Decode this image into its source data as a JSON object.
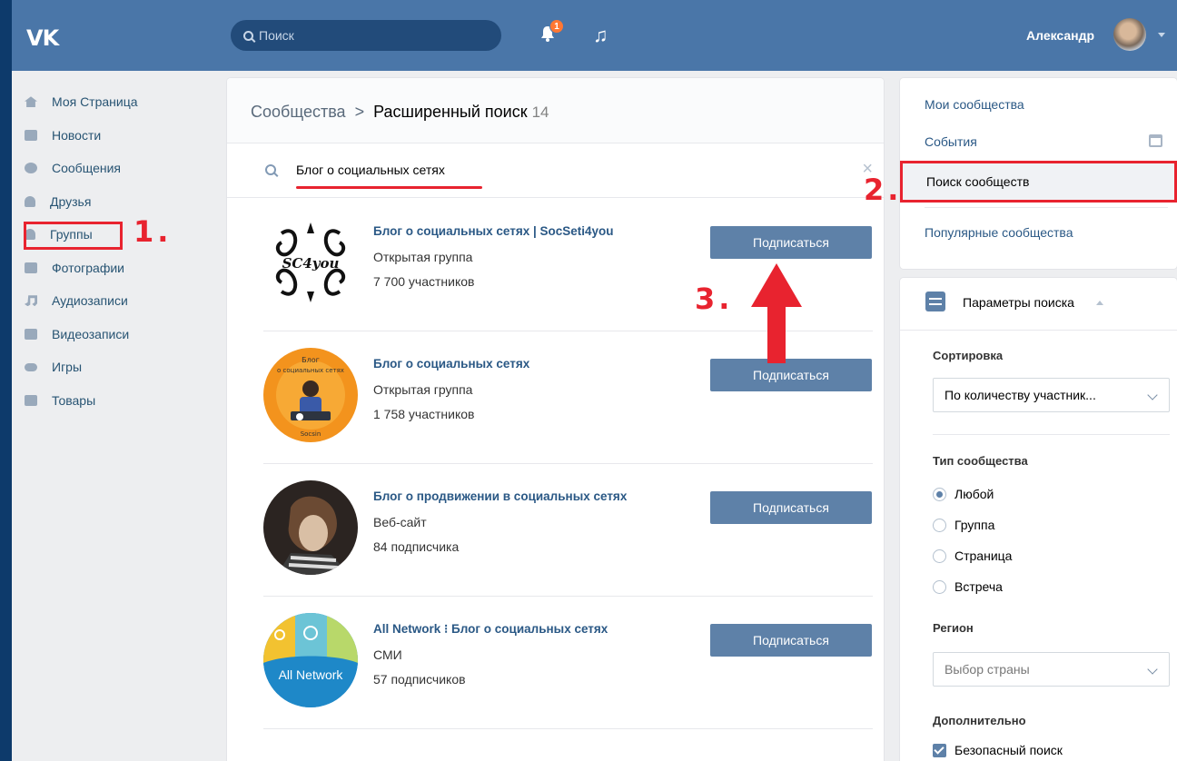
{
  "header": {
    "logo": "VK",
    "search_placeholder": "Поиск",
    "notifications_count": "1",
    "user_name": "Александр"
  },
  "nav": {
    "items": [
      {
        "label": "Моя Страница",
        "icon": "home-icon"
      },
      {
        "label": "Новости",
        "icon": "news-icon"
      },
      {
        "label": "Сообщения",
        "icon": "messages-icon"
      },
      {
        "label": "Друзья",
        "icon": "friends-icon"
      },
      {
        "label": "Группы",
        "icon": "groups-icon"
      },
      {
        "label": "Фотографии",
        "icon": "photos-icon"
      },
      {
        "label": "Аудиозаписи",
        "icon": "music-icon"
      },
      {
        "label": "Видеозаписи",
        "icon": "video-icon"
      },
      {
        "label": "Игры",
        "icon": "games-icon"
      },
      {
        "label": "Товары",
        "icon": "goods-icon"
      }
    ]
  },
  "annotations": {
    "step1": "1.",
    "step2": "2.",
    "step3": "3.",
    "highlight_color": "#e8232f"
  },
  "main": {
    "breadcrumb_root": "Сообщества",
    "breadcrumb_sep": ">",
    "breadcrumb_current": "Расширенный поиск",
    "result_count": "14",
    "query": "Блог о социальных сетях",
    "groups": [
      {
        "name": "Блог о социальных сетях | SocSeti4you",
        "type": "Открытая группа",
        "members": "7 700 участников",
        "button": "Подписаться"
      },
      {
        "name": "Блог о социальных сетях",
        "type": "Открытая группа",
        "members": "1 758 участников",
        "button": "Подписаться"
      },
      {
        "name": "Блог о продвижении в социальных сетях",
        "type": "Веб-сайт",
        "members": "84 подписчика",
        "button": "Подписаться"
      },
      {
        "name": "All Network ⁝ Блог о социальных сетях",
        "type": "СМИ",
        "members": "57 подписчиков",
        "button": "Подписаться"
      }
    ],
    "avatar_texts": {
      "g1": "SC4you",
      "g2_top": "Блог",
      "g2_mid": "о социальных сетях",
      "g2_bottom": "Socsin",
      "g4": "All Network"
    }
  },
  "right": {
    "links": [
      "Мои сообщества",
      "События",
      "Поиск сообществ",
      "Популярные сообщества"
    ],
    "params_title": "Параметры поиска",
    "sort_label": "Сортировка",
    "sort_value": "По количеству участник...",
    "type_label": "Тип сообщества",
    "type_options": [
      "Любой",
      "Группа",
      "Страница",
      "Встреча"
    ],
    "type_selected": "Любой",
    "region_label": "Регион",
    "region_placeholder": "Выбор страны",
    "extra_label": "Дополнительно",
    "safe_search": "Безопасный поиск"
  }
}
